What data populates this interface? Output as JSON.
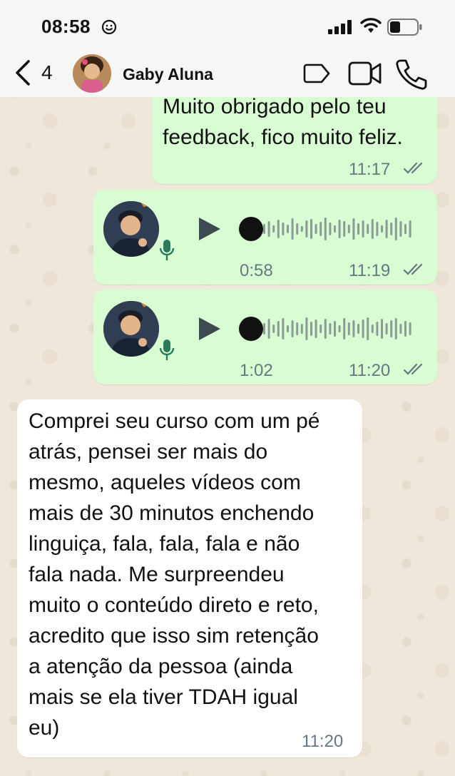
{
  "status": {
    "time": "08:58"
  },
  "header": {
    "unread_count": "4",
    "contact_name": "Gaby Aluna"
  },
  "messages": [
    {
      "direction": "out",
      "type": "text",
      "lines": [
        "Muito obrigado pelo teu",
        "feedback, fico muito feliz."
      ],
      "time": "11:17",
      "status": "read"
    },
    {
      "direction": "out",
      "type": "voice",
      "duration": "0:58",
      "time": "11:19",
      "status": "read"
    },
    {
      "direction": "out",
      "type": "voice",
      "duration": "1:02",
      "time": "11:20",
      "status": "read"
    },
    {
      "direction": "in",
      "type": "text",
      "lines": [
        "Comprei seu curso com um pé",
        "atrás, pensei ser mais do",
        "mesmo, aqueles vídeos com",
        "mais de 30 minutos enchendo",
        "linguiça, fala, fala, fala e não",
        "fala nada. Me surpreendeu",
        "muito o conteúdo direto e reto,",
        "acredito que isso sim retenção",
        "a atenção da pessoa (ainda",
        "mais se ela tiver TDAH igual",
        "eu)"
      ],
      "time": "11:20"
    }
  ],
  "colors": {
    "outgoing_bubble": "#d9fdd3",
    "incoming_bubble": "#ffffff",
    "header_bg": "#f6f6f6",
    "meta_text": "#667781"
  }
}
